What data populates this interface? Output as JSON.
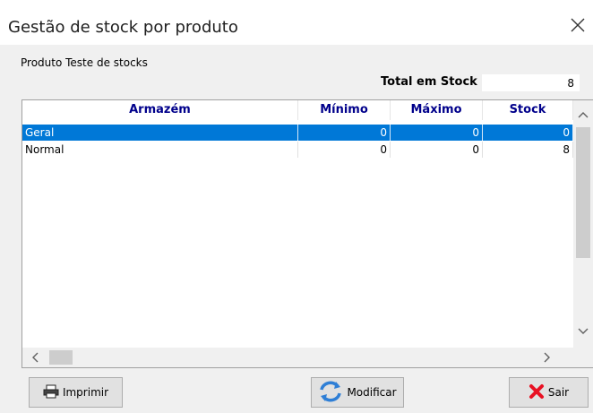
{
  "window": {
    "title": "Gestão de stock por produto"
  },
  "product": {
    "name": "Produto Teste de stocks"
  },
  "total": {
    "label": "Total em Stock",
    "value": "8"
  },
  "grid": {
    "columns": [
      "Armazém",
      "Mínimo",
      "Máximo",
      "Stock"
    ],
    "rows": [
      {
        "armazem": "Geral",
        "minimo": "0",
        "maximo": "0",
        "stock": "0",
        "selected": true
      },
      {
        "armazem": "Normal",
        "minimo": "0",
        "maximo": "0",
        "stock": "8",
        "selected": false
      }
    ]
  },
  "buttons": {
    "print": "Imprimir",
    "modify": "Modificar",
    "exit": "Sair"
  },
  "colors": {
    "selection": "#0078d7",
    "header_text": "#00008b",
    "exit_icon": "#e81123",
    "modify_icon": "#2f7fd6"
  }
}
